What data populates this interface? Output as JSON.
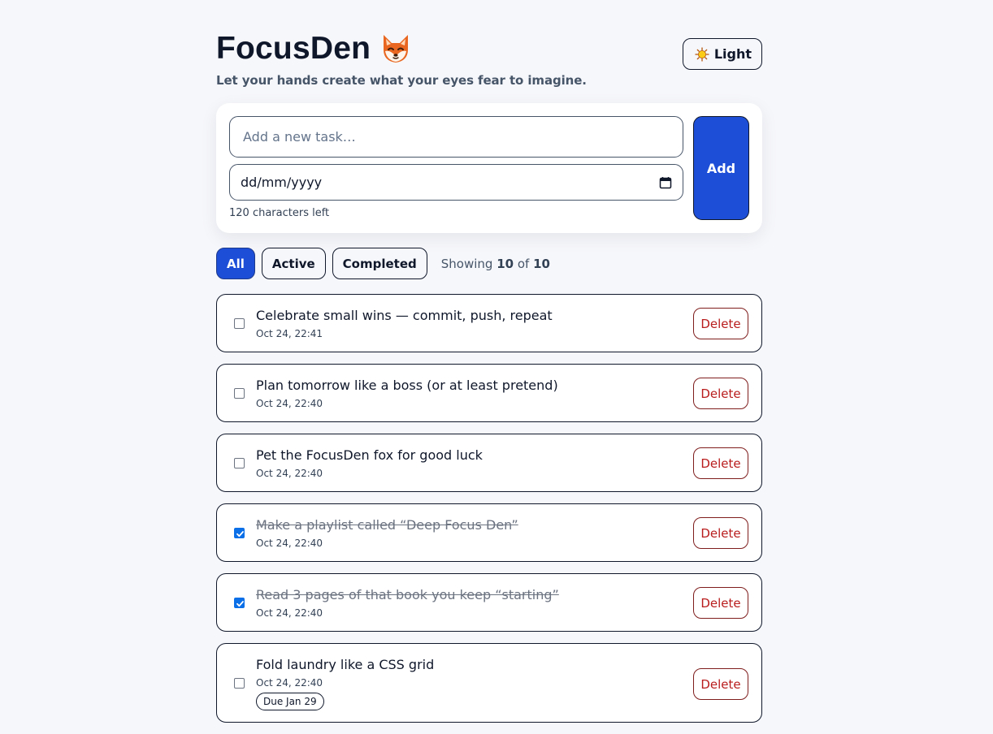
{
  "header": {
    "title": "FocusDen",
    "title_icon": "fox-icon",
    "subtitle": "Let your hands create what your eyes fear to imagine.",
    "theme_toggle": {
      "icon": "sun-icon",
      "label": "Light"
    }
  },
  "composer": {
    "task_placeholder": "Add a new task…",
    "task_value": "",
    "date_placeholder": "dd/mm/yyyy",
    "date_icon": "calendar-icon",
    "chars_left": "120 characters left",
    "add_label": "Add"
  },
  "filters": {
    "items": [
      {
        "label": "All",
        "active": true
      },
      {
        "label": "Active",
        "active": false
      },
      {
        "label": "Completed",
        "active": false
      }
    ],
    "showing_prefix": "Showing",
    "showing_count": "10",
    "showing_of": "of",
    "showing_total": "10"
  },
  "tasks": [
    {
      "text": "Celebrate small wins — commit, push, repeat",
      "time": "Oct 24, 22:41",
      "done": false,
      "due": "",
      "delete_label": "Delete"
    },
    {
      "text": "Plan tomorrow like a boss (or at least pretend)",
      "time": "Oct 24, 22:40",
      "done": false,
      "due": "",
      "delete_label": "Delete"
    },
    {
      "text": "Pet the FocusDen fox for good luck",
      "time": "Oct 24, 22:40",
      "done": false,
      "due": "",
      "delete_label": "Delete"
    },
    {
      "text": "Make a playlist called “Deep Focus Den”",
      "time": "Oct 24, 22:40",
      "done": true,
      "due": "",
      "delete_label": "Delete"
    },
    {
      "text": "Read 3 pages of that book you keep “starting”",
      "time": "Oct 24, 22:40",
      "done": true,
      "due": "",
      "delete_label": "Delete"
    },
    {
      "text": "Fold laundry like a CSS grid",
      "time": "Oct 24, 22:40",
      "done": false,
      "due": "Due Jan 29",
      "delete_label": "Delete"
    }
  ],
  "colors": {
    "accent": "#1d4ed8",
    "background": "#f6f7fb",
    "danger": "#b91c1c",
    "checkbox_checked": "#0b6fe8"
  }
}
